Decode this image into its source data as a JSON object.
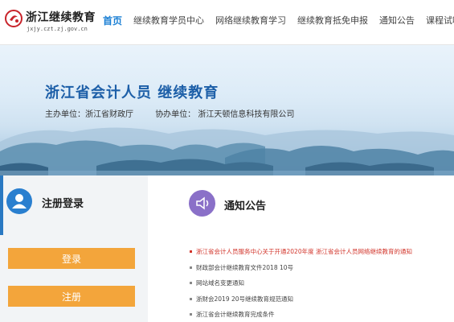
{
  "header": {
    "logo_title": "浙江继续教育",
    "logo_domain": "jxjy.czt.zj.gov.cn",
    "nav": [
      {
        "label": "首页",
        "active": true
      },
      {
        "label": "继续教育学员中心"
      },
      {
        "label": "网络继续教育学习"
      },
      {
        "label": "继续教育抵免申报"
      },
      {
        "label": "通知公告"
      },
      {
        "label": "课程试听"
      }
    ]
  },
  "banner": {
    "title": "浙江省会计人员 继续教育",
    "host_label": "主办单位：浙江省财政厅",
    "co_host_label": "协办单位： 浙江天顿信息科技有限公司"
  },
  "login": {
    "heading": "注册登录",
    "login_button": "登录",
    "register_button": "注册"
  },
  "notices": {
    "heading": "通知公告",
    "items": [
      "浙江省会计人员服务中心关于开通2020年度 浙江省会计人员网络继续教育的通知",
      "财政部会计继续教育文件2018 10号",
      "网站域名变更通知",
      "浙财会2019 20号继续教育规范通知",
      "浙江省会计继续教育完成条件"
    ]
  },
  "colors": {
    "nav_active": "#1a7fd4",
    "banner_title": "#1d5fa8",
    "button": "#f3a53b",
    "user_icon_bg": "#2a7fcf",
    "notice_icon_bg": "#8a70c8",
    "hot_notice": "#d2352b"
  },
  "icons": {
    "logo": "logo-emblem-icon",
    "user": "user-icon",
    "notice": "speaker-icon"
  }
}
